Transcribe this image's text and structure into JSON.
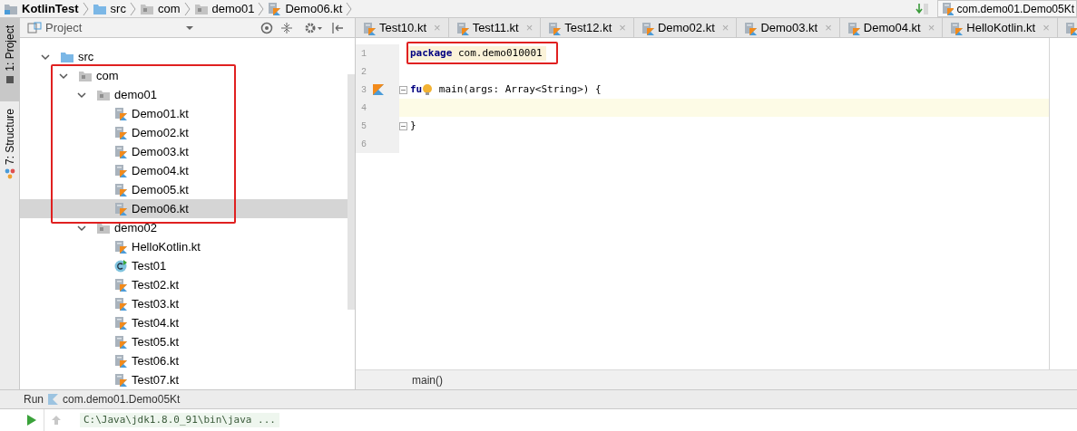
{
  "breadcrumbs": [
    {
      "kind": "project",
      "label": "KotlinTest"
    },
    {
      "kind": "folder",
      "label": "src"
    },
    {
      "kind": "package",
      "label": "com"
    },
    {
      "kind": "package",
      "label": "demo01"
    },
    {
      "kind": "file",
      "label": "Demo06.kt"
    }
  ],
  "run_config": {
    "label": "com.demo01.Demo05Kt"
  },
  "side_tabs": [
    {
      "label": "1: Project",
      "selected": true
    },
    {
      "label": "7: Structure",
      "selected": false
    }
  ],
  "project_panel": {
    "title": "Project",
    "tree": [
      {
        "label": "src",
        "kind": "source",
        "expanded": true,
        "selected": false,
        "children": [
          {
            "label": "com",
            "kind": "package",
            "expanded": true,
            "selected": false,
            "children": [
              {
                "label": "demo01",
                "kind": "package",
                "expanded": true,
                "selected": false,
                "children": [
                  {
                    "label": "Demo01.kt",
                    "kind": "kotlin",
                    "selected": false
                  },
                  {
                    "label": "Demo02.kt",
                    "kind": "kotlin",
                    "selected": false
                  },
                  {
                    "label": "Demo03.kt",
                    "kind": "kotlin",
                    "selected": false
                  },
                  {
                    "label": "Demo04.kt",
                    "kind": "kotlin",
                    "selected": false
                  },
                  {
                    "label": "Demo05.kt",
                    "kind": "kotlin",
                    "selected": false
                  },
                  {
                    "label": "Demo06.kt",
                    "kind": "kotlin",
                    "selected": true
                  }
                ]
              },
              {
                "label": "demo02",
                "kind": "package",
                "expanded": true,
                "selected": false,
                "children": [
                  {
                    "label": "HelloKotlin.kt",
                    "kind": "kotlin",
                    "selected": false
                  },
                  {
                    "label": "Test01",
                    "kind": "class",
                    "selected": false
                  },
                  {
                    "label": "Test02.kt",
                    "kind": "kotlin",
                    "selected": false
                  },
                  {
                    "label": "Test03.kt",
                    "kind": "kotlin",
                    "selected": false
                  },
                  {
                    "label": "Test04.kt",
                    "kind": "kotlin",
                    "selected": false
                  },
                  {
                    "label": "Test05.kt",
                    "kind": "kotlin",
                    "selected": false
                  },
                  {
                    "label": "Test06.kt",
                    "kind": "kotlin",
                    "selected": false
                  },
                  {
                    "label": "Test07.kt",
                    "kind": "kotlin",
                    "selected": false
                  }
                ]
              }
            ]
          }
        ]
      }
    ]
  },
  "editor_tabs": [
    {
      "label": "Test10.kt",
      "selected": false
    },
    {
      "label": "Test11.kt",
      "selected": false
    },
    {
      "label": "Test12.kt",
      "selected": false
    },
    {
      "label": "Demo02.kt",
      "selected": false
    },
    {
      "label": "Demo03.kt",
      "selected": false
    },
    {
      "label": "Demo04.kt",
      "selected": false
    },
    {
      "label": "HelloKotlin.kt",
      "selected": false
    }
  ],
  "close_glyph": "×",
  "code_lines": [
    {
      "number": "1",
      "current": false,
      "tokens": [
        {
          "kind": "keyword",
          "text": "package"
        },
        {
          "kind": "plain",
          "text": " com.demo010001"
        }
      ]
    },
    {
      "number": "2",
      "current": false
    },
    {
      "number": "3",
      "current": false,
      "run_marker": true,
      "fold": true,
      "tokens": [
        {
          "kind": "keyword",
          "text": "fu"
        },
        {
          "kind": "bulb"
        },
        {
          "kind": "plain",
          "text": " main(args: Array<String>) {"
        }
      ]
    },
    {
      "number": "4",
      "current": true
    },
    {
      "number": "5",
      "current": false,
      "fold": true,
      "tokens": [
        {
          "kind": "plain",
          "text": "}"
        }
      ]
    },
    {
      "number": "6",
      "current": false
    }
  ],
  "editor_breadcrumb": "main()",
  "run_panel": {
    "title": "Run",
    "config": "com.demo01.Demo05Kt",
    "console": "C:\\Java\\jdk1.8.0_91\\bin\\java ..."
  }
}
